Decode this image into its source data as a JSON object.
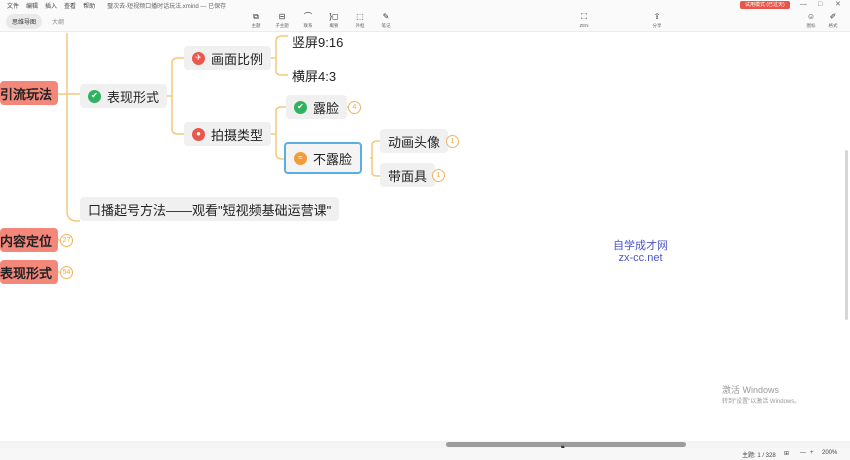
{
  "menu": {
    "items": [
      "文件",
      "编辑",
      "插入",
      "查看",
      "帮助"
    ],
    "doc_title": "璧次去-短视频口播时话玩法.xmind — 已保存",
    "trial_label": "试用模式 (已过天)"
  },
  "window_controls": [
    "—",
    "□",
    "✕"
  ],
  "tabs": [
    "思维导图",
    "大纲"
  ],
  "toolbar": [
    {
      "label": "主题",
      "icon": "topic-icon",
      "glyph": "⧉"
    },
    {
      "label": "子主题",
      "icon": "subtopic-icon",
      "glyph": "⊟"
    },
    {
      "label": "联系",
      "icon": "relationship-icon",
      "glyph": "⌒"
    },
    {
      "label": "概要",
      "icon": "summary-icon",
      "glyph": "}◻"
    },
    {
      "label": "外框",
      "icon": "boundary-icon",
      "glyph": "⬚"
    },
    {
      "label": "笔记",
      "icon": "note-icon",
      "glyph": "✎"
    },
    {
      "label": "ZEN",
      "icon": "zen-icon",
      "glyph": "⛶"
    },
    {
      "label": "分享",
      "icon": "share-icon",
      "glyph": "⇪"
    },
    {
      "label": "图标",
      "icon": "emoji-icon",
      "glyph": "☺"
    },
    {
      "label": "格式",
      "icon": "format-icon",
      "glyph": "✐"
    }
  ],
  "mindmap": {
    "main_topics": [
      "引流玩法",
      "内容定位",
      "表现形式"
    ],
    "main_counts": {
      "content": "27",
      "form": "54"
    },
    "subtopics": {
      "expression": "表现形式",
      "ratio": "画面比例",
      "vertical": "竖屏9:16",
      "horizontal": "横屏4:3",
      "shoot_type": "拍摄类型",
      "show_face": "露脸",
      "show_face_count": "4",
      "no_face": "不露脸",
      "animation": "动画头像",
      "animation_count": "1",
      "mask": "带面具",
      "mask_count": "1",
      "opening": "口播起号方法——观看\"短视频基础运营课\""
    }
  },
  "watermark": {
    "line1": "自学成才网",
    "line2": "zx-cc.net"
  },
  "activate_windows": {
    "line1": "激活 Windows",
    "line2": "转到\"设置\"以激活 Windows。"
  },
  "statusbar": {
    "topic_count": "主题: 1 / 328",
    "zoom": "200%"
  },
  "colors": {
    "main_topic": "#f2877a",
    "branch_line": "#f2c97d",
    "selection": "#5aaee6",
    "watermark": "#4a54c9"
  }
}
